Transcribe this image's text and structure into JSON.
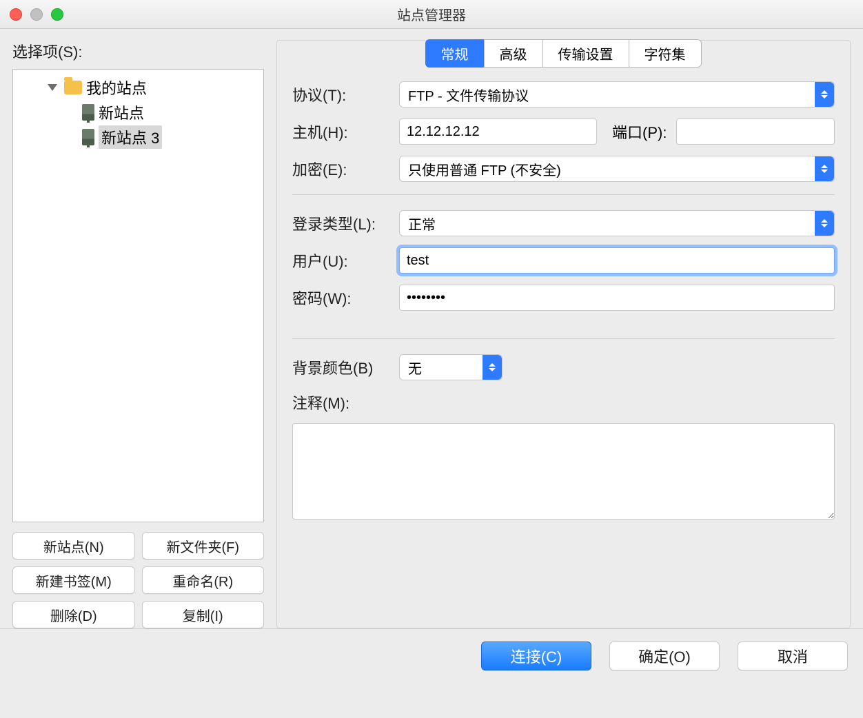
{
  "window": {
    "title": "站点管理器"
  },
  "left": {
    "select_label": "选择项(S):",
    "tree": {
      "root": "我的站点",
      "items": [
        "新站点",
        "新站点 3"
      ],
      "selected_index": 1
    },
    "buttons": {
      "new_site": "新站点(N)",
      "new_folder": "新文件夹(F)",
      "new_bookmark": "新建书签(M)",
      "rename": "重命名(R)",
      "delete": "删除(D)",
      "copy": "复制(I)"
    }
  },
  "tabs": [
    "常规",
    "高级",
    "传输设置",
    "字符集"
  ],
  "active_tab": 0,
  "form": {
    "protocol_label": "协议(T):",
    "protocol_value": "FTP - 文件传输协议",
    "host_label": "主机(H):",
    "host_value": "12.12.12.12",
    "port_label": "端口(P):",
    "port_value": "",
    "encryption_label": "加密(E):",
    "encryption_value": "只使用普通 FTP (不安全)",
    "logon_type_label": "登录类型(L):",
    "logon_type_value": "正常",
    "user_label": "用户(U):",
    "user_value": "test",
    "password_label": "密码(W):",
    "password_value": "••••••••",
    "bgcolor_label": "背景颜色(B)",
    "bgcolor_value": "无",
    "comment_label": "注释(M):",
    "comment_value": ""
  },
  "footer": {
    "connect": "连接(C)",
    "ok": "确定(O)",
    "cancel": "取消"
  }
}
